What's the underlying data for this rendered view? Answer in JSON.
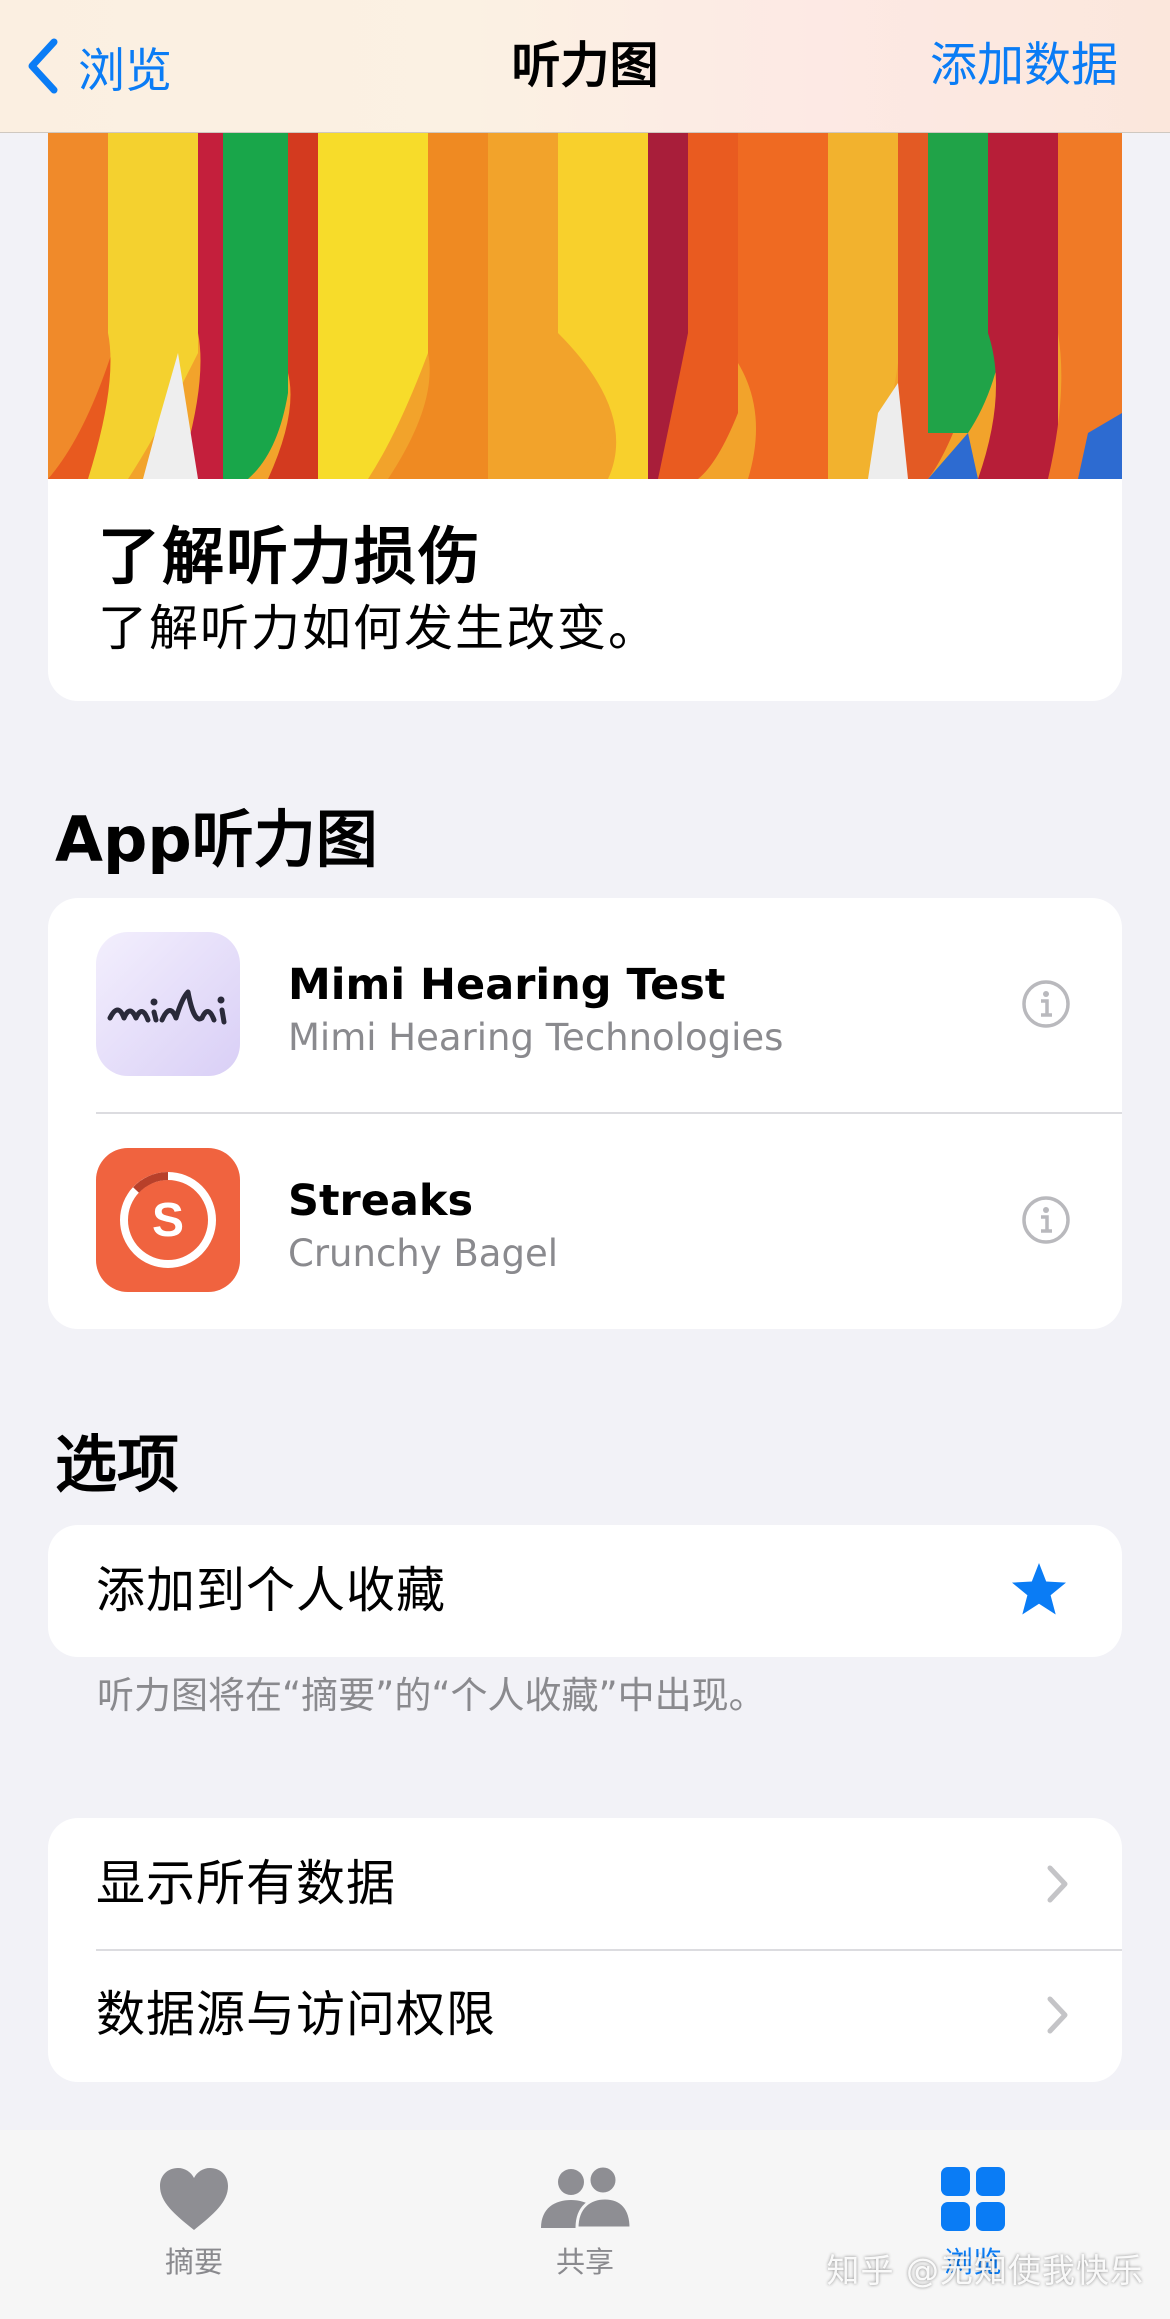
{
  "nav": {
    "back_label": "浏览",
    "title": "听力图",
    "add_label": "添加数据"
  },
  "hero": {
    "title": "了解听力损伤",
    "subtitle": "了解听力如何发生改变。"
  },
  "apps_section": {
    "title": "App听力图",
    "apps": [
      {
        "name": "Mimi Hearing Test",
        "developer": "Mimi Hearing Technologies",
        "icon": "mimi-app-icon",
        "icon_text": "mimi"
      },
      {
        "name": "Streaks",
        "developer": "Crunchy Bagel",
        "icon": "streaks-app-icon",
        "icon_text": "S"
      }
    ]
  },
  "options_section": {
    "title": "选项",
    "favorite_label": "添加到个人收藏",
    "footnote": "听力图将在“摘要”的“个人收藏”中出现。"
  },
  "data_rows": [
    {
      "label": "显示所有数据"
    },
    {
      "label": "数据源与访问权限"
    }
  ],
  "tabbar": {
    "tabs": [
      {
        "label": "摘要",
        "icon": "heart-icon",
        "active": false
      },
      {
        "label": "共享",
        "icon": "people-icon",
        "active": false
      },
      {
        "label": "浏览",
        "icon": "grid-icon",
        "active": true
      }
    ]
  },
  "watermark": "知乎 @无知使我快乐",
  "colors": {
    "accent": "#0a7cf5",
    "background": "#f2f2f7",
    "secondary_text": "#8a8a8e",
    "streaks_orange": "#f0633f"
  }
}
